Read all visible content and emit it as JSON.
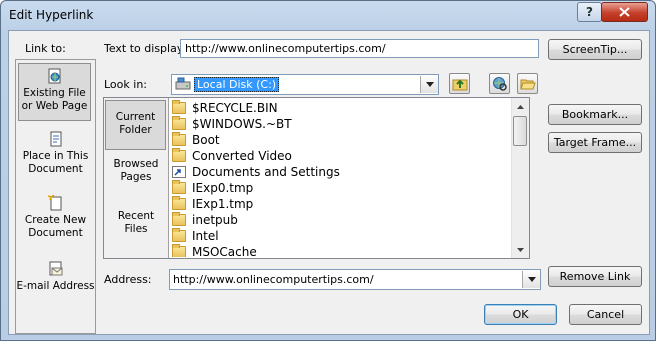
{
  "window": {
    "title": "Edit Hyperlink",
    "help_label": "?",
    "close_label": "X"
  },
  "link_to": {
    "label": "Link to:",
    "items": [
      {
        "label": "Existing File or Web Page",
        "icon": "globe-page-icon",
        "selected": true
      },
      {
        "label": "Place in This Document",
        "icon": "document-icon",
        "selected": false
      },
      {
        "label": "Create New Document",
        "icon": "new-document-icon",
        "selected": false
      },
      {
        "label": "E-mail Address",
        "icon": "email-icon",
        "selected": false
      }
    ]
  },
  "text_to_display": {
    "label": "Text to display:",
    "value": "http://www.onlinecomputertips.com/"
  },
  "screentip_button": "ScreenTip...",
  "look_in": {
    "label": "Look in:",
    "value": "Local Disk (C:)"
  },
  "browse_tabs": [
    {
      "label": "Current Folder",
      "selected": true
    },
    {
      "label": "Browsed Pages",
      "selected": false
    },
    {
      "label": "Recent Files",
      "selected": false
    }
  ],
  "files": [
    {
      "name": "$RECYCLE.BIN",
      "icon": "folder-icon"
    },
    {
      "name": "$WINDOWS.~BT",
      "icon": "folder-icon"
    },
    {
      "name": "Boot",
      "icon": "folder-icon"
    },
    {
      "name": "Converted Video",
      "icon": "folder-icon"
    },
    {
      "name": "Documents and Settings",
      "icon": "shortcut-folder-icon"
    },
    {
      "name": "IExp0.tmp",
      "icon": "folder-icon"
    },
    {
      "name": "IExp1.tmp",
      "icon": "folder-icon"
    },
    {
      "name": "inetpub",
      "icon": "folder-icon"
    },
    {
      "name": "Intel",
      "icon": "folder-icon"
    },
    {
      "name": "MSOCache",
      "icon": "folder-icon"
    }
  ],
  "right_buttons": {
    "bookmark": "Bookmark...",
    "target_frame": "Target Frame...",
    "remove_link": "Remove Link"
  },
  "address": {
    "label": "Address:",
    "value": "http://www.onlinecomputertips.com/"
  },
  "footer": {
    "ok": "OK",
    "cancel": "Cancel"
  },
  "colors": {
    "title_gradient_top": "#c9dbee",
    "selection_blue": "#3399ff",
    "close_red": "#c5402a"
  }
}
